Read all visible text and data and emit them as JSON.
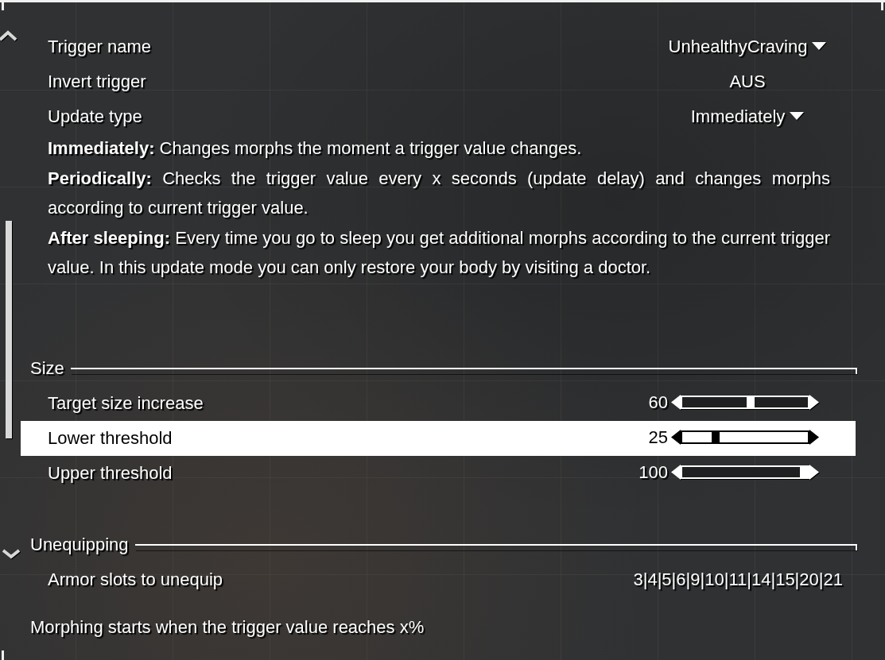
{
  "options": [
    {
      "kind": "dropdown",
      "label": "Trigger name",
      "value": "UnhealthyCraving",
      "selected": false
    },
    {
      "kind": "toggle",
      "label": "Invert trigger",
      "value": "AUS",
      "selected": false
    },
    {
      "kind": "dropdown",
      "label": "Update type",
      "value": "Immediately",
      "selected": false
    }
  ],
  "description": [
    "**Immediately:** Changes morphs the moment a trigger value changes.",
    "**Periodically:** Checks the trigger value every x seconds (update delay) and changes morphs according to current trigger value.",
    "**After sleeping:** Every time you go to sleep you get additional morphs according to the current trigger value. In this update mode you can only restore your body by visiting a doctor."
  ],
  "sections": [
    {
      "title": "Size",
      "items": [
        {
          "kind": "slider",
          "label": "Target size increase",
          "value": "60",
          "level": 0.55,
          "selected": false
        },
        {
          "kind": "slider",
          "label": "Lower threshold",
          "value": "25",
          "level": 0.25,
          "selected": true
        },
        {
          "kind": "slider",
          "label": "Upper threshold",
          "value": "100",
          "level": 1,
          "selected": false
        }
      ]
    },
    {
      "title": "Unequipping",
      "items": [
        {
          "kind": "text",
          "label": "Armor slots to unequip",
          "value": "3|4|5|6|9|10|11|14|15|20|21",
          "selected": false
        }
      ]
    }
  ],
  "info_text": "Morphing starts when the trigger value reaches x%"
}
